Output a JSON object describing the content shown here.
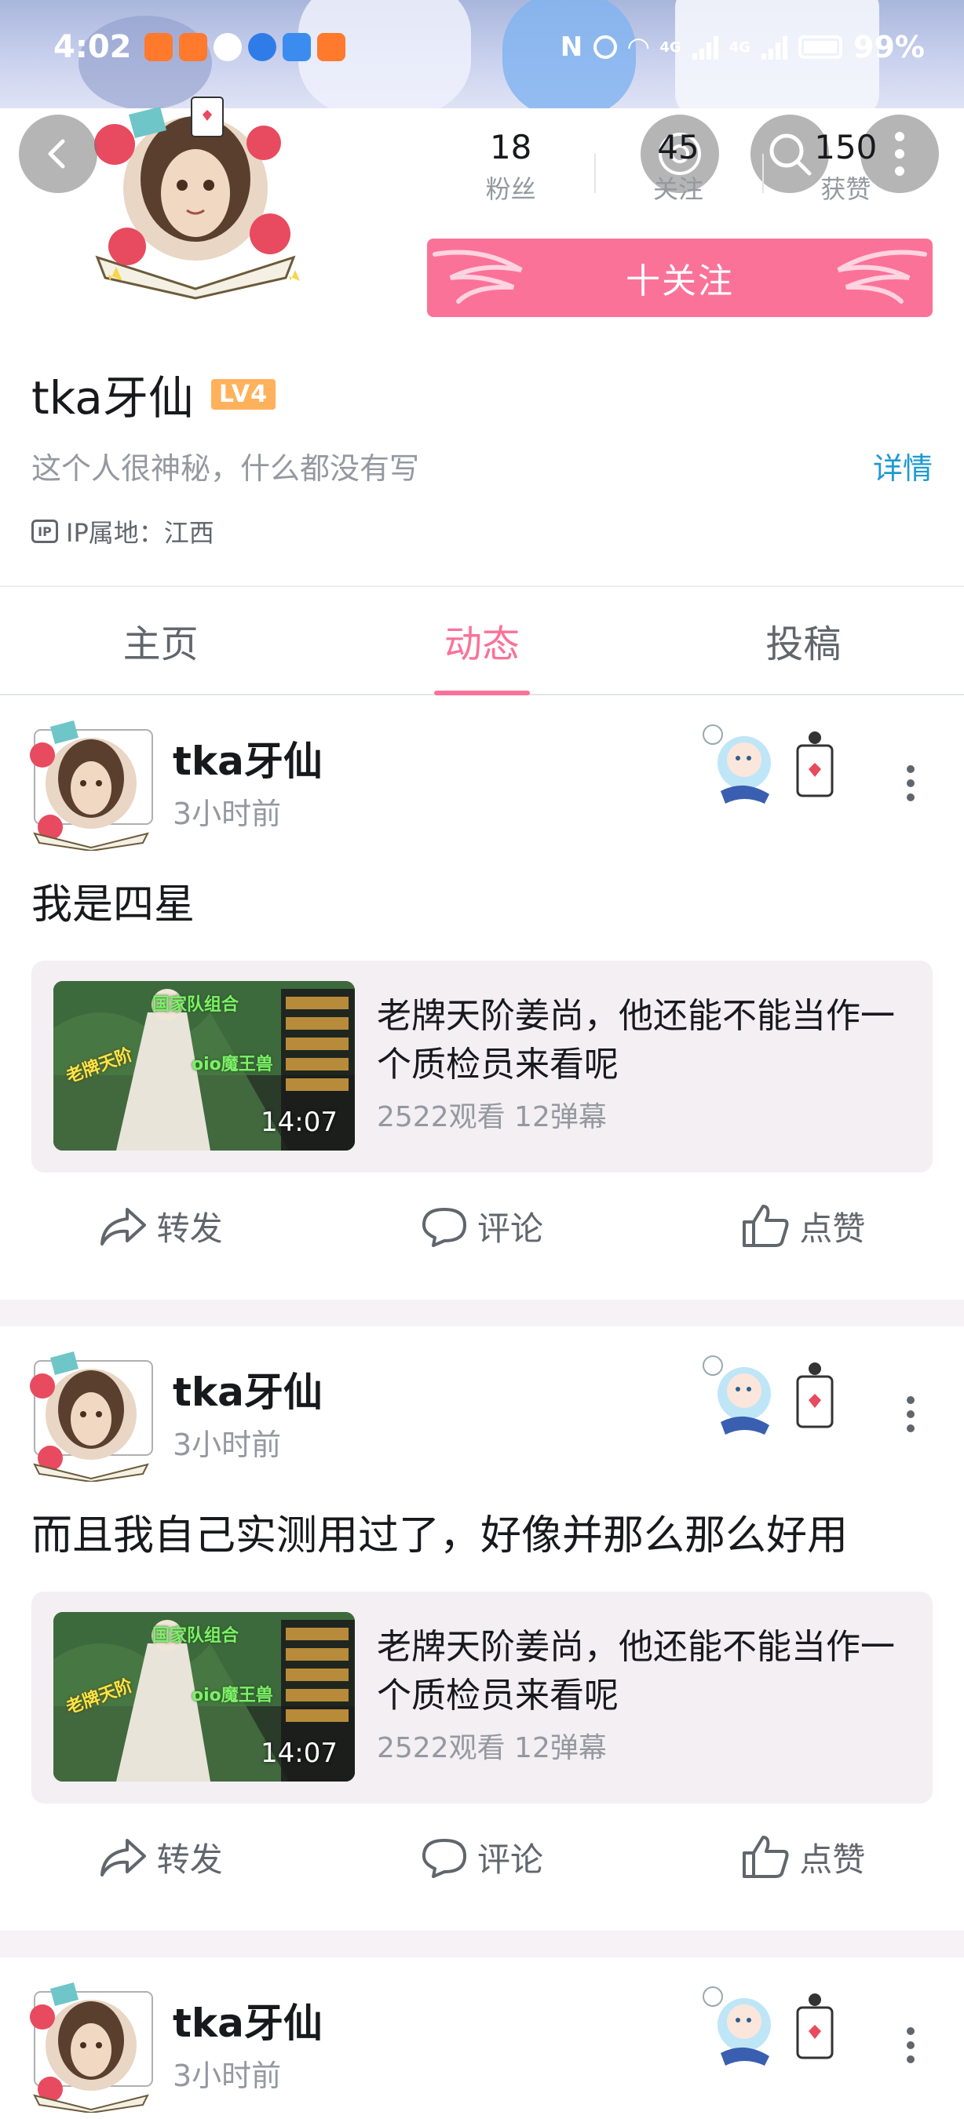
{
  "status_bar": {
    "time": "4:02",
    "battery": "99%",
    "net1": "4G",
    "net2": "4G"
  },
  "profile": {
    "stats": [
      {
        "value": "18",
        "label": "粉丝"
      },
      {
        "value": "45",
        "label": "关注"
      },
      {
        "value": "150",
        "label": "获赞"
      }
    ],
    "follow_label": "十关注",
    "username": "tka牙仙",
    "level": "LV4",
    "bio": "这个人很神秘，什么都没有写",
    "details_link": "详情",
    "ip_icon": "IP",
    "ip_location": "IP属地：江西"
  },
  "tabs": [
    {
      "label": "主页",
      "active": false
    },
    {
      "label": "动态",
      "active": true
    },
    {
      "label": "投稿",
      "active": false
    }
  ],
  "posts": [
    {
      "author": "tka牙仙",
      "time": "3小时前",
      "text": "我是四星",
      "video": {
        "title": "老牌天阶姜尚，他还能不能当作一个质检员来看呢",
        "duration": "14:07",
        "meta": "2522观看 12弹幕",
        "thumb_text_1": "国家队组合",
        "thumb_text_2": "老牌天阶",
        "thumb_text_3": "oio魔王兽"
      },
      "actions": {
        "share": "转发",
        "comment": "评论",
        "like": "点赞"
      }
    },
    {
      "author": "tka牙仙",
      "time": "3小时前",
      "text": "而且我自己实测用过了，好像并那么那么好用",
      "video": {
        "title": "老牌天阶姜尚，他还能不能当作一个质检员来看呢",
        "duration": "14:07",
        "meta": "2522观看 12弹幕",
        "thumb_text_1": "国家队组合",
        "thumb_text_2": "老牌天阶",
        "thumb_text_3": "oio魔王兽"
      },
      "actions": {
        "share": "转发",
        "comment": "评论",
        "like": "点赞"
      }
    },
    {
      "author": "tka牙仙",
      "time": "3小时前"
    }
  ],
  "colors": {
    "accent_pink": "#fb7299",
    "link_blue": "#1e9ad0",
    "level_orange": "#ffb15c",
    "text_primary": "#18191c",
    "text_secondary": "#9499a0",
    "card_bg": "#f4eff3"
  },
  "icons": {
    "back": "back-arrow-icon",
    "share_top": "share-icon",
    "search": "search-icon",
    "more": "more-vertical-icon",
    "post_share": "share-arrow-icon",
    "post_comment": "comment-icon",
    "post_like": "thumbs-up-icon"
  }
}
